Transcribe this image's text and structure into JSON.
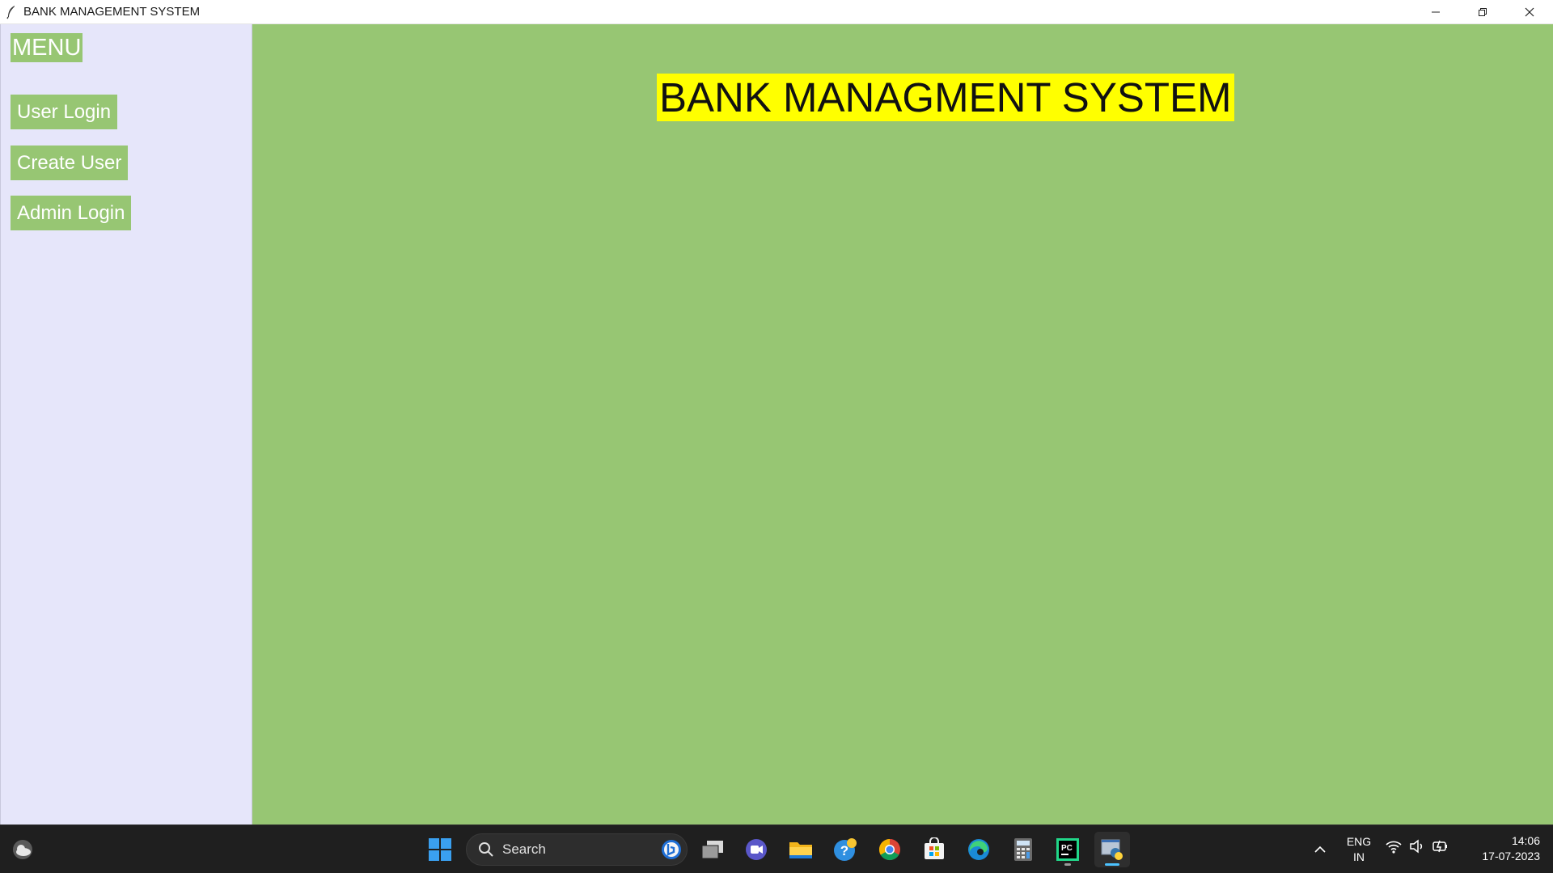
{
  "window": {
    "title": "BANK MANAGEMENT SYSTEM"
  },
  "sidebar": {
    "menu_label": "MENU",
    "items": [
      {
        "label": "User Login"
      },
      {
        "label": "Create User"
      },
      {
        "label": "Admin Login"
      }
    ]
  },
  "main": {
    "heading": "BANK MANAGMENT SYSTEM"
  },
  "taskbar": {
    "search_label": "Search",
    "language_line1": "ENG",
    "language_line2": "IN",
    "time": "14:06",
    "date": "17-07-2023"
  },
  "colors": {
    "main_bg": "#97c673",
    "sidebar_bg": "#e6e6fa",
    "heading_bg": "#ffff00",
    "button_bg": "#97c673",
    "taskbar_bg": "#1f1f1f"
  },
  "icons": {
    "app": "feather-icon",
    "taskbar": [
      "weather-icon",
      "windows-start-icon",
      "search-icon",
      "bing-icon",
      "task-view-icon",
      "meet-icon",
      "file-explorer-icon",
      "help-icon",
      "chrome-icon",
      "store-icon",
      "edge-icon",
      "calculator-icon",
      "pycharm-icon",
      "python-app-icon",
      "chevron-up-icon",
      "wifi-icon",
      "volume-icon",
      "battery-icon"
    ]
  }
}
